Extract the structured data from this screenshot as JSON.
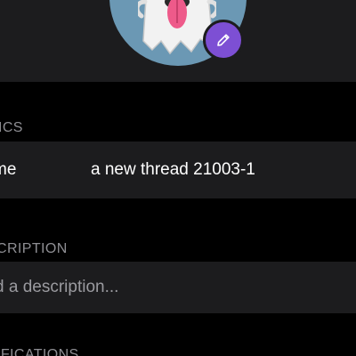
{
  "avatar": {
    "emoji_icon": "ghost-icon",
    "edit_icon": "pencil-icon",
    "circle_color": "#6b98b4",
    "badge_color": "#7d4fd4"
  },
  "basics": {
    "header": "ICS",
    "name_label": "me",
    "name_value": "a new thread 21003-1"
  },
  "description": {
    "header": "CRIPTION",
    "placeholder": "d a description..."
  },
  "notifications": {
    "header": "IFICATIONS"
  },
  "colors": {
    "background": "#000000",
    "row_background": "#1c1c1e",
    "secondary_text": "#8e8e93"
  }
}
